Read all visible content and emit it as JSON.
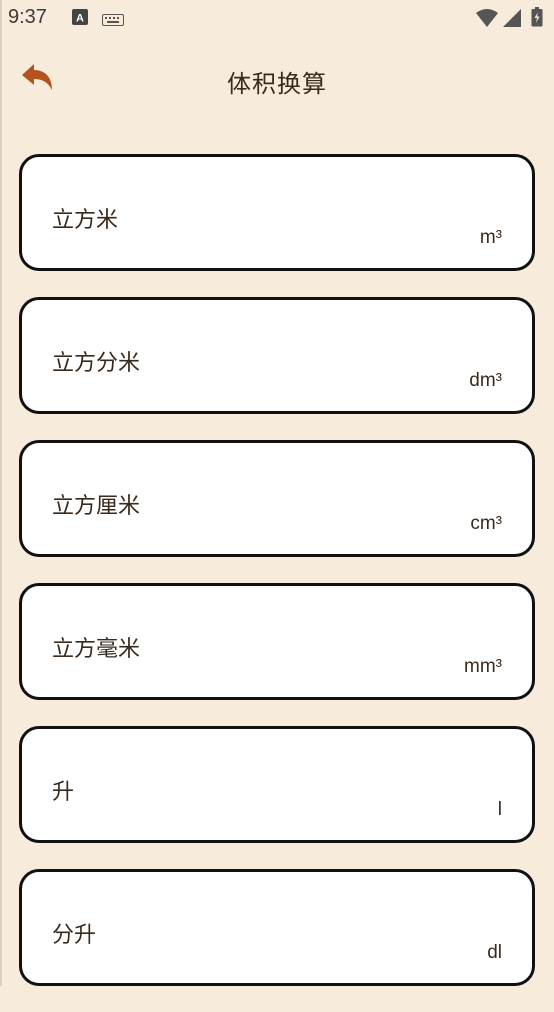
{
  "status_bar": {
    "time": "9:37",
    "left_icons": [
      "a-box-icon",
      "keyboard-icon"
    ],
    "right_icons": [
      "wifi-icon",
      "signal-icon",
      "battery-icon"
    ]
  },
  "header": {
    "back_icon": "back-arrow-icon",
    "title": "体积换算"
  },
  "units": [
    {
      "name": "立方米",
      "symbol": "m³"
    },
    {
      "name": "立方分米",
      "symbol": "dm³"
    },
    {
      "name": "立方厘米",
      "symbol": "cm³"
    },
    {
      "name": "立方毫米",
      "symbol": "mm³"
    },
    {
      "name": "升",
      "symbol": "l"
    },
    {
      "name": "分升",
      "symbol": "dl"
    }
  ],
  "colors": {
    "background": "#f7ebdb",
    "accent": "#b5531f",
    "card_border": "#111111",
    "text": "#3a2a1d"
  }
}
